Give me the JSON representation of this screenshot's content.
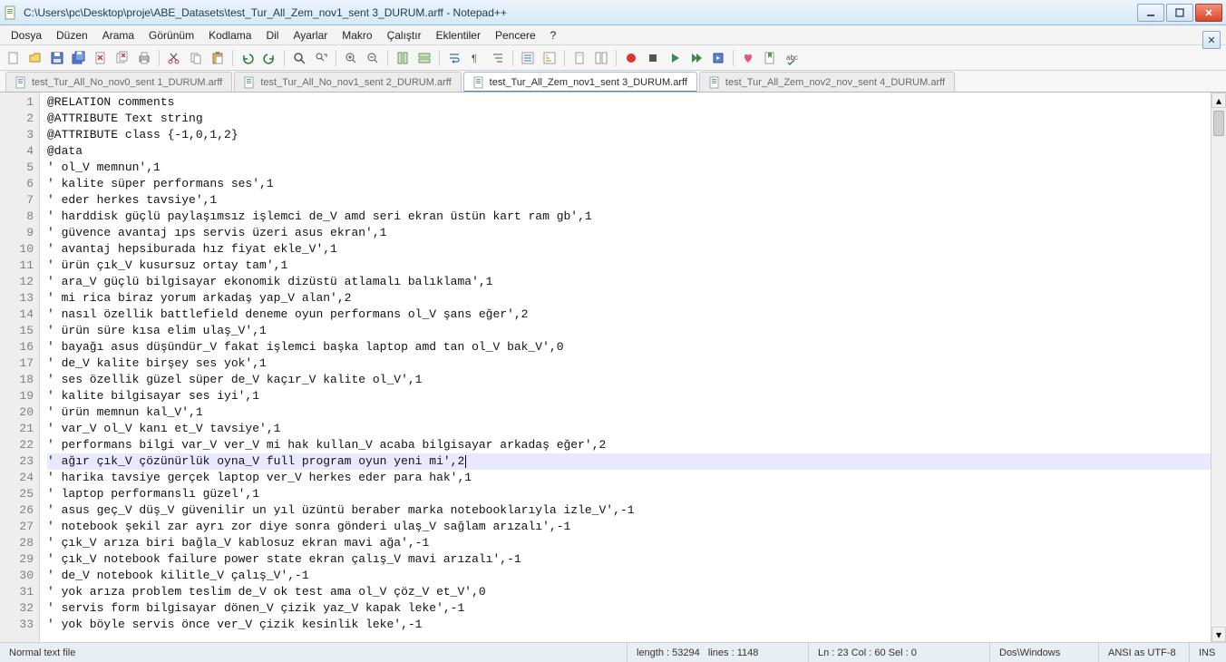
{
  "window": {
    "title": "C:\\Users\\pc\\Desktop\\proje\\ABE_Datasets\\test_Tur_All_Zem_nov1_sent 3_DURUM.arff - Notepad++"
  },
  "menu": [
    "Dosya",
    "Düzen",
    "Arama",
    "Görünüm",
    "Kodlama",
    "Dil",
    "Ayarlar",
    "Makro",
    "Çalıştır",
    "Eklentiler",
    "Pencere",
    "?"
  ],
  "tabs": [
    {
      "label": "test_Tur_All_No_nov0_sent 1_DURUM.arff",
      "active": false
    },
    {
      "label": "test_Tur_All_No_nov1_sent 2_DURUM.arff",
      "active": false
    },
    {
      "label": "test_Tur_All_Zem_nov1_sent 3_DURUM.arff",
      "active": true
    },
    {
      "label": "test_Tur_All_Zem_nov2_nov_sent 4_DURUM.arff",
      "active": false
    }
  ],
  "lines": [
    "@RELATION comments",
    "@ATTRIBUTE Text string",
    "@ATTRIBUTE class {-1,0,1,2}",
    "@data",
    "' ol_V memnun',1",
    "' kalite süper performans ses',1",
    "' eder herkes tavsiye',1",
    "' harddisk güçlü paylaşımsız işlemci de_V amd seri ekran üstün kart ram gb',1",
    "' güvence avantaj ıps servis üzeri asus ekran',1",
    "' avantaj hepsiburada hız fiyat ekle_V',1",
    "' ürün çık_V kusursuz ortay tam',1",
    "' ara_V güçlü bilgisayar ekonomik dizüstü atlamalı balıklama',1",
    "' mi rica biraz yorum arkadaş yap_V alan',2",
    "' nasıl özellik battlefield deneme oyun performans ol_V şans eğer',2",
    "' ürün süre kısa elim ulaş_V',1",
    "' bayağı asus düşündür_V fakat işlemci başka laptop amd tan ol_V bak_V',0",
    "' de_V kalite birşey ses yok',1",
    "' ses özellik güzel süper de_V kaçır_V kalite ol_V',1",
    "' kalite bilgisayar ses iyi',1",
    "' ürün memnun kal_V',1",
    "' var_V ol_V kanı et_V tavsiye',1",
    "' performans bilgi var_V ver_V mi hak kullan_V acaba bilgisayar arkadaş eğer',2",
    "' ağır çık_V çözünürlük oyna_V full program oyun yeni mi',2",
    "' harika tavsiye gerçek laptop ver_V herkes eder para hak',1",
    "' laptop performanslı güzel',1",
    "' asus geç_V düş_V güvenilir un yıl üzüntü beraber marka notebooklarıyla izle_V',-1",
    "' notebook şekil zar ayrı zor diye sonra gönderi ulaş_V sağlam arızalı',-1",
    "' çık_V arıza biri bağla_V kablosuz ekran mavi ağa',-1",
    "' çık_V notebook failure power state ekran çalış_V mavi arızalı',-1",
    "' de_V notebook kilitle_V çalış_V',-1",
    "' yok arıza problem teslim de_V ok test ama ol_V çöz_V et_V',0",
    "' servis form bilgisayar dönen_V çizik yaz_V kapak leke',-1",
    "' yok böyle servis önce ver_V çizik kesinlik leke',-1"
  ],
  "current_line_index": 22,
  "status": {
    "filetype": "Normal text file",
    "length": "length : 53294",
    "lines": "lines : 1148",
    "pos": "Ln : 23   Col : 60   Sel : 0",
    "eol": "Dos\\Windows",
    "encoding": "ANSI as UTF-8",
    "mode": "INS"
  }
}
